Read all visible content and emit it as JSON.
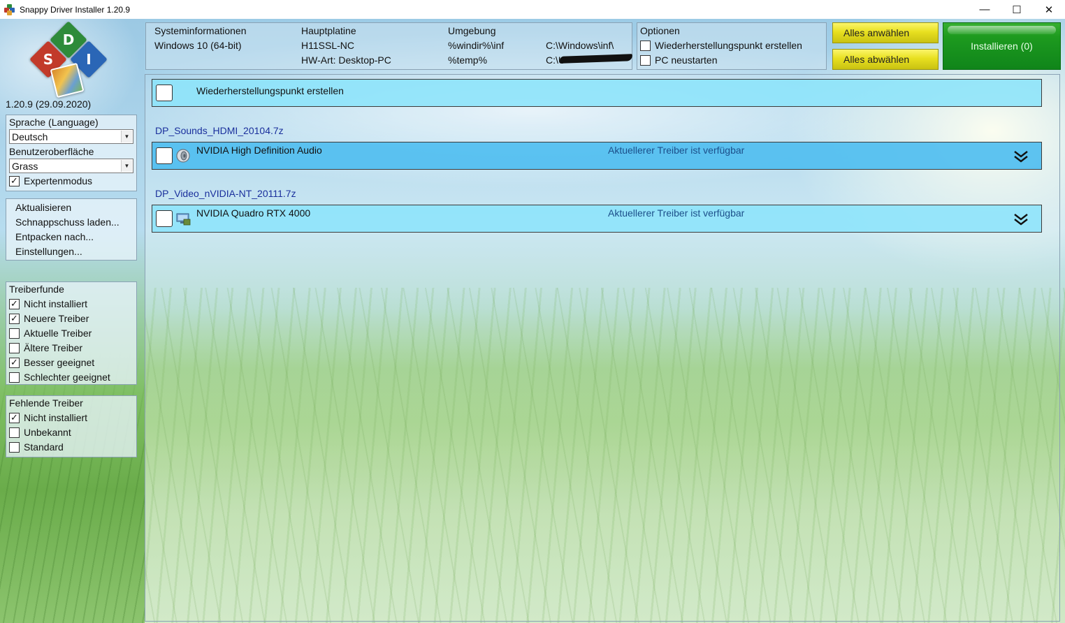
{
  "window": {
    "title": "Snappy Driver Installer 1.20.9",
    "controls": {
      "minimize": "—",
      "maximize": "☐",
      "close": "✕"
    }
  },
  "logo": {
    "letters": [
      "D",
      "S",
      "I"
    ]
  },
  "version_text": "1.20.9 (29.09.2020)",
  "settings": {
    "language_label": "Sprache (Language)",
    "language_value": "Deutsch",
    "theme_label": "Benutzeroberfläche",
    "theme_value": "Grass",
    "expert_mode": {
      "label": "Expertenmodus",
      "checked": true
    }
  },
  "menu": {
    "items": [
      "Aktualisieren",
      "Schnappschuss laden...",
      "Entpacken nach...",
      "Einstellungen..."
    ]
  },
  "filters_found": {
    "title": "Treiberfunde",
    "items": [
      {
        "label": "Nicht installiert",
        "checked": true
      },
      {
        "label": "Neuere Treiber",
        "checked": true
      },
      {
        "label": "Aktuelle Treiber",
        "checked": false
      },
      {
        "label": "Ältere Treiber",
        "checked": false
      },
      {
        "label": "Besser geeignet",
        "checked": true
      },
      {
        "label": "Schlechter geeignet",
        "checked": false
      }
    ]
  },
  "filters_missing": {
    "title": "Fehlende Treiber",
    "items": [
      {
        "label": "Nicht installiert",
        "checked": true
      },
      {
        "label": "Unbekannt",
        "checked": false
      },
      {
        "label": "Standard",
        "checked": false
      }
    ]
  },
  "sysinfo": {
    "col1_header": "Systeminformationen",
    "os": "Windows 10 (64-bit)",
    "col2_header": "Hauptplatine",
    "board": "H11SSL-NC",
    "hw_type": "HW-Art: Desktop-PC",
    "col3_header": "Umgebung",
    "env1_key": "%windir%\\inf",
    "env1_val": "C:\\Windows\\inf\\",
    "env2_key": "%temp%",
    "env2_val": "C:\\U"
  },
  "options": {
    "title": "Optionen",
    "items": [
      {
        "label": "Wiederherstellungspunkt erstellen",
        "checked": false
      },
      {
        "label": "PC neustarten",
        "checked": false
      }
    ]
  },
  "buttons": {
    "select_all": "Alles anwählen",
    "deselect_all": "Alles abwählen",
    "install": "Installieren (0)"
  },
  "list": {
    "restore_row": "Wiederherstellungspunkt erstellen",
    "packages": [
      {
        "name": "DP_Sounds_HDMI_20104.7z",
        "driver": "NVIDIA High Definition Audio",
        "status": "Aktuellerer Treiber ist verfügbar",
        "icon": "speaker-icon"
      },
      {
        "name": "DP_Video_nVIDIA-NT_20111.7z",
        "driver": "NVIDIA Quadro RTX 4000",
        "status": "Aktuellerer Treiber ist verfügbar",
        "icon": "display-adapter-icon"
      }
    ]
  },
  "colors": {
    "row_light": "#8ce4fa",
    "row_dark": "#50bef0",
    "package_label": "#1a2f9c",
    "status_text": "#1c4f8a",
    "install_green": "#10851a",
    "select_yellow": "#e8e020"
  }
}
